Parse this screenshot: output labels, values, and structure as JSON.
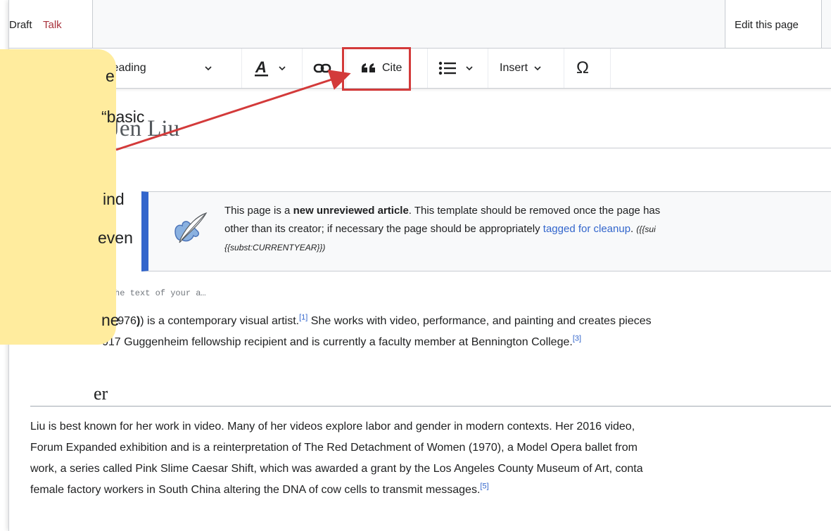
{
  "tabs": {
    "draft": "Draft",
    "talk": "Talk",
    "edit": "Edit this page"
  },
  "toolbar": {
    "heading": "Heading",
    "cite": "Cite",
    "insert": "Insert",
    "special": "Ω"
  },
  "page": {
    "title": "Jen Liu",
    "placeholder": "he text of your a…"
  },
  "notice": {
    "line1_a": "This page is a ",
    "line1_b": "new unreviewed article",
    "line1_c": ". This template should be removed once the page has",
    "line2_a": "other than its creator; if necessary the page should be appropriately ",
    "line2_link": "tagged for cleanup",
    "line2_b": ". ",
    "line2_c": "({{sui",
    "line3": "{{subst:CURRENTYEAR}})"
  },
  "intro": {
    "line1_a": "n 1976",
    "line1_b": ") is a contemporary visual artist.",
    "ref1": "[1]",
    "line1_c": " She works with video, performance, and painting and creates pieces",
    "line2_a": "017 Guggenheim fellowship recipient and is currently a faculty member at Bennington College.",
    "ref3": "[3]"
  },
  "section": {
    "heading_fragment": "er",
    "line1": "Liu is best known for her work in video. Many of her videos explore labor and gender in modern contexts.  Her 2016 video,",
    "line2": "Forum Expanded exhibition and is a reinterpretation of The Red Detachment of Women (1970), a Model Opera ballet from",
    "line3": "work, a series called Pink Slime Caesar Shift, which was awarded a grant by the Los Angeles County Museum of Art, conta",
    "line4": "female factory workers in South China altering the DNA of cow cells to transmit messages.",
    "ref5": "[5]"
  },
  "callout": {
    "line1": "e",
    "line2": "“basic",
    "line3": "ind",
    "line4": "even",
    "line5": "ne"
  },
  "colors": {
    "accent": "#3366cc",
    "highlight": "#d33a3a",
    "callout": "#ffec9e"
  }
}
